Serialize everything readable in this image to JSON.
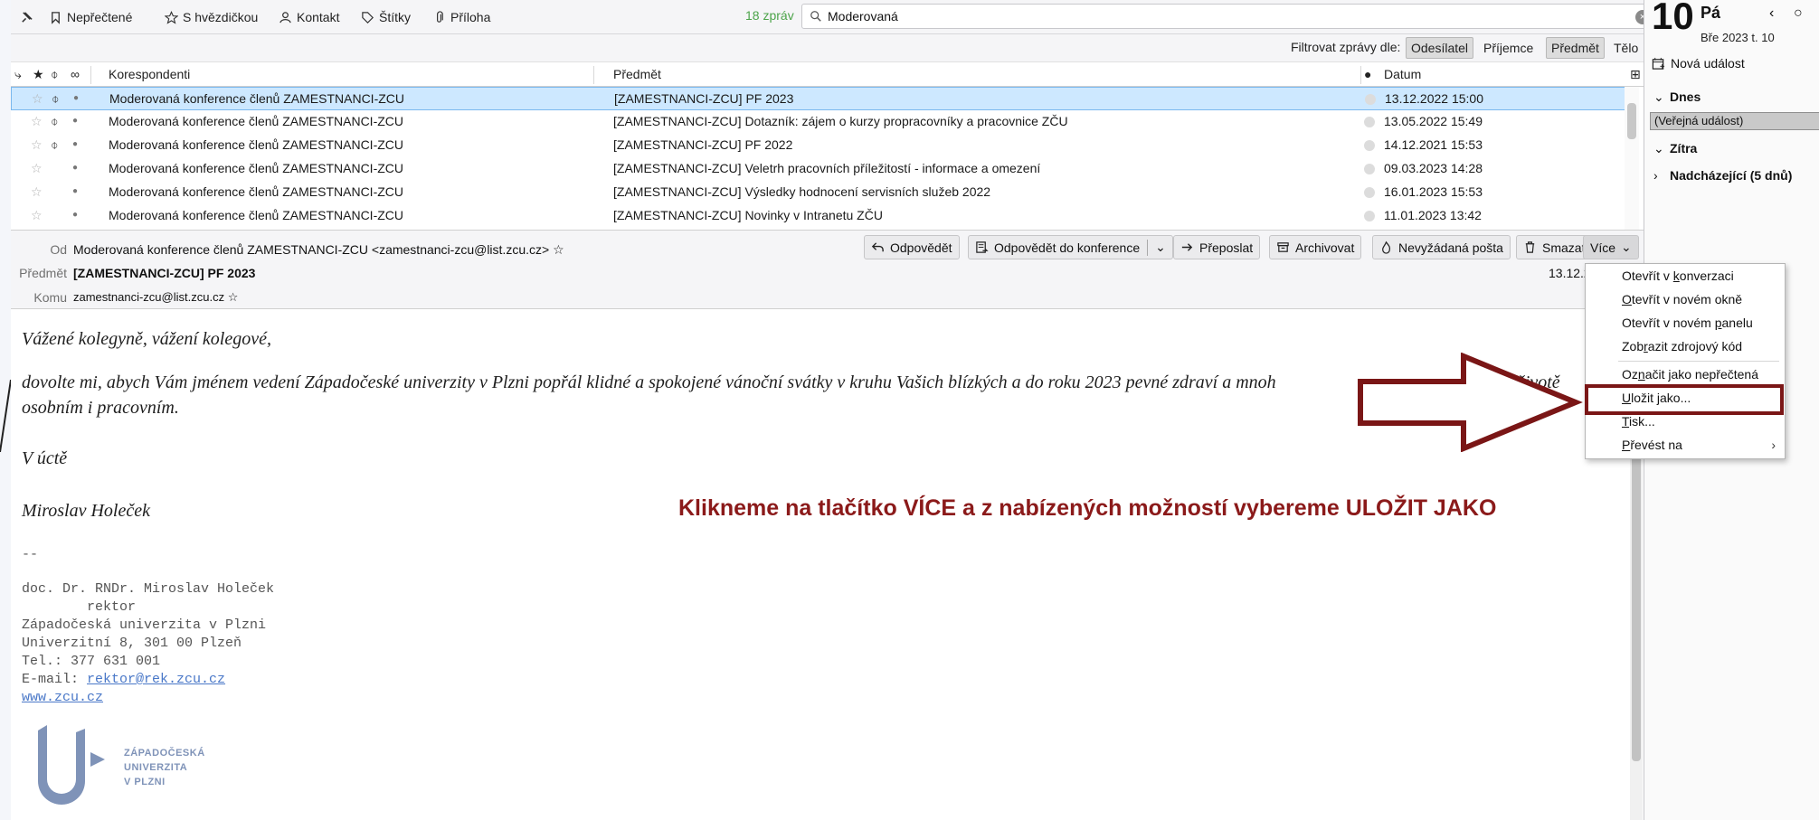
{
  "toolbar": {
    "unread": "Nepřečtené",
    "starred": "S hvězdičkou",
    "contact": "Kontakt",
    "tags": "Štítky",
    "attachment": "Příloha",
    "count": "18 zpráv",
    "search_value": "Moderovaná"
  },
  "filter": {
    "label": "Filtrovat zprávy dle:",
    "buttons": [
      "Odesílatel",
      "Příjemce",
      "Předmět",
      "Tělo"
    ]
  },
  "columns": {
    "correspondents": "Korespondenti",
    "subject": "Předmět",
    "date": "Datum"
  },
  "messages": [
    {
      "from": "Moderovaná konference členů ZAMESTNANCI-ZCU",
      "subject": "[ZAMESTNANCI-ZCU] PF 2023",
      "date": "13.12.2022 15:00",
      "attach": true,
      "selected": true
    },
    {
      "from": "Moderovaná konference členů ZAMESTNANCI-ZCU",
      "subject": "[ZAMESTNANCI-ZCU] Dotazník: zájem o kurzy propracovníky a pracovnice ZČU",
      "date": "13.05.2022 15:49",
      "attach": true,
      "selected": false
    },
    {
      "from": "Moderovaná konference členů ZAMESTNANCI-ZCU",
      "subject": "[ZAMESTNANCI-ZCU] PF 2022",
      "date": "14.12.2021 15:53",
      "attach": true,
      "selected": false
    },
    {
      "from": "Moderovaná konference členů ZAMESTNANCI-ZCU",
      "subject": "[ZAMESTNANCI-ZCU] Veletrh pracovních příležitostí - informace a omezení",
      "date": "09.03.2023 14:28",
      "attach": false,
      "selected": false
    },
    {
      "from": "Moderovaná konference členů ZAMESTNANCI-ZCU",
      "subject": "[ZAMESTNANCI-ZCU] Výsledky hodnocení servisních služeb 2022",
      "date": "16.01.2023 15:53",
      "attach": false,
      "selected": false
    },
    {
      "from": "Moderovaná konference členů ZAMESTNANCI-ZCU",
      "subject": "[ZAMESTNANCI-ZCU] Novinky v Intranetu ZČU",
      "date": "11.01.2023 13:42",
      "attach": false,
      "selected": false
    }
  ],
  "header": {
    "from_label": "Od",
    "from_value": "Moderovaná konference členů ZAMESTNANCI-ZCU <zamestnanci-zcu@list.zcu.cz>",
    "subject_label": "Předmět",
    "subject_value": "[ZAMESTNANCI-ZCU] PF 2023",
    "to_label": "Komu",
    "to_value": "zamestnanci-zcu@list.zcu.cz",
    "date_partial": "13.12.2"
  },
  "actions": {
    "reply": "Odpovědět",
    "reply_list": "Odpovědět do konference",
    "forward": "Přeposlat",
    "archive": "Archivovat",
    "junk": "Nevyžádaná pošta",
    "delete": "Smazat",
    "more": "Více"
  },
  "body": {
    "greeting": "Vážené kolegyně, vážení kolegové,",
    "para1a": "dovolte mi, abych Vám jménem vedení Západočeské univerzity v Plzni popřál klidné a spokojené vánoční svátky v kruhu Vašich blízkých a do roku 2023 pevné zdraví a mnoh",
    "para1b": "osobním i pracovním.",
    "para1_tail": "životě",
    "closing": "V úctě",
    "name": "Miroslav Holeček",
    "sigsep": "--",
    "sig1": "doc. Dr. RNDr. Miroslav Holeček",
    "sig2": "        rektor",
    "sig3": "Západočeská univerzita v Plzni",
    "sig4": "Univerzitní 8, 301 00 Plzeň",
    "sig5": "Tel.: 377 631 001",
    "sig6_label": "E-mail: ",
    "sig6_link": "rektor@rek.zcu.cz",
    "sig7_link": "www.zcu.cz",
    "logo_line1": "ZÁPADOČESKÁ",
    "logo_line2": "UNIVERZITA",
    "logo_line3": "V PLZNI"
  },
  "annotation": "Klikneme na tlačítko VÍCE a z nabízených možností vybereme ULOŽIT JAKO",
  "menu": {
    "items": [
      {
        "pre": "Otevřít v ",
        "u": "k",
        "post": "onverzaci"
      },
      {
        "pre": "",
        "u": "O",
        "post": "tevřít v novém okně"
      },
      {
        "pre": "Otevřít v novém ",
        "u": "p",
        "post": "anelu"
      },
      {
        "pre": "Zob",
        "u": "r",
        "post": "azit zdrojový kód"
      },
      {
        "pre": "Oz",
        "u": "n",
        "post": "ačit jako nepřečtená"
      },
      {
        "pre": "",
        "u": "U",
        "post": "ložit jako..."
      },
      {
        "pre": "",
        "u": "T",
        "post": "isk..."
      },
      {
        "pre": "",
        "u": "P",
        "post": "řevést na"
      }
    ]
  },
  "calendar": {
    "day_number": "10",
    "day_name": "Pá",
    "month_week": "Bře 2023  t. 10",
    "new_event": "Nová událost",
    "today": "Dnes",
    "today_event": "(Veřejná událost)",
    "tomorrow": "Zítra",
    "upcoming": "Nadcházející (5 dnů)"
  },
  "colors": {
    "accent_red": "#8b1a1a",
    "selection": "#cde8ff",
    "count_green": "#4ca44a",
    "logo_blue": "#7f93b8"
  }
}
